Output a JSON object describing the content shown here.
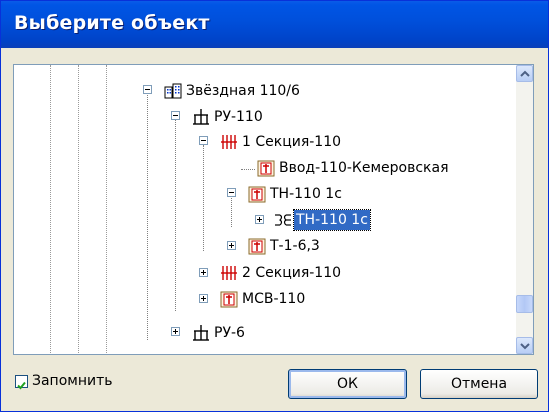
{
  "dialog": {
    "title": "Выберите объект",
    "remember_label": "Запомнить",
    "remember_checked": true,
    "ok_label": "ОК",
    "cancel_label": "Отмена"
  },
  "tree": {
    "items": [
      {
        "label": "Звёздная 110/6",
        "icon": "substation-icon",
        "state": "expanded"
      },
      {
        "label": "РУ-110",
        "icon": "switchgear-icon",
        "state": "expanded"
      },
      {
        "label": "1 Секция-110",
        "icon": "busbar-section-icon",
        "state": "expanded"
      },
      {
        "label": "Ввод-110-Кемеровская",
        "icon": "cell-icon",
        "state": "leaf"
      },
      {
        "label": "ТН-110 1с",
        "icon": "cell-icon",
        "state": "expanded"
      },
      {
        "label": "ТН-110 1с",
        "icon": "voltage-transformer-icon",
        "state": "collapsed",
        "selected": true
      },
      {
        "label": "Т-1-6,3",
        "icon": "cell-icon",
        "state": "collapsed"
      },
      {
        "label": "2 Секция-110",
        "icon": "busbar-section-icon",
        "state": "collapsed"
      },
      {
        "label": "МСВ-110",
        "icon": "cell-icon",
        "state": "collapsed"
      },
      {
        "label": "РУ-6",
        "icon": "switchgear-icon",
        "state": "collapsed"
      }
    ]
  },
  "colors": {
    "title_bar": "#0055e5",
    "selection": "#316ac5",
    "cell_icon_red": "#cc0000",
    "checkbox_tick": "#21a121"
  }
}
